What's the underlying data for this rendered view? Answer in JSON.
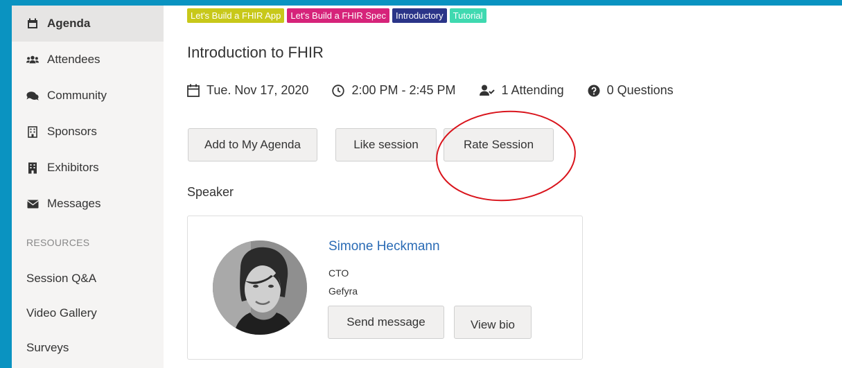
{
  "sidebar": {
    "items": [
      {
        "label": "Agenda",
        "icon": "calendar-icon",
        "active": true
      },
      {
        "label": "Attendees",
        "icon": "users-icon"
      },
      {
        "label": "Community",
        "icon": "comments-icon"
      },
      {
        "label": "Sponsors",
        "icon": "building-outline-icon"
      },
      {
        "label": "Exhibitors",
        "icon": "building-icon"
      },
      {
        "label": "Messages",
        "icon": "envelope-icon"
      }
    ],
    "resources_heading": "RESOURCES",
    "resources": [
      {
        "label": "Session Q&A"
      },
      {
        "label": "Video Gallery"
      },
      {
        "label": "Surveys"
      }
    ]
  },
  "session": {
    "tags": [
      {
        "label": "Let's Build a FHIR App",
        "color": "#c8c81a"
      },
      {
        "label": "Let's Build a FHIR Spec",
        "color": "#d6237a"
      },
      {
        "label": "Introductory",
        "color": "#2a3488"
      },
      {
        "label": "Tutorial",
        "color": "#3fd9b0"
      }
    ],
    "title": "Introduction to FHIR",
    "date": "Tue. Nov 17, 2020",
    "time": "2:00 PM - 2:45 PM",
    "attending": "1 Attending",
    "questions": "0 Questions",
    "buttons": {
      "add": "Add to My Agenda",
      "like": "Like session",
      "rate": "Rate Session"
    },
    "speaker_heading": "Speaker"
  },
  "speaker": {
    "name": "Simone Heckmann",
    "role": "CTO",
    "org": "Gefyra",
    "send_message": "Send message",
    "view_bio": "View bio"
  },
  "colors": {
    "background": "#0a93c1",
    "link": "#2a6bb5",
    "annotation": "#d9141c"
  }
}
